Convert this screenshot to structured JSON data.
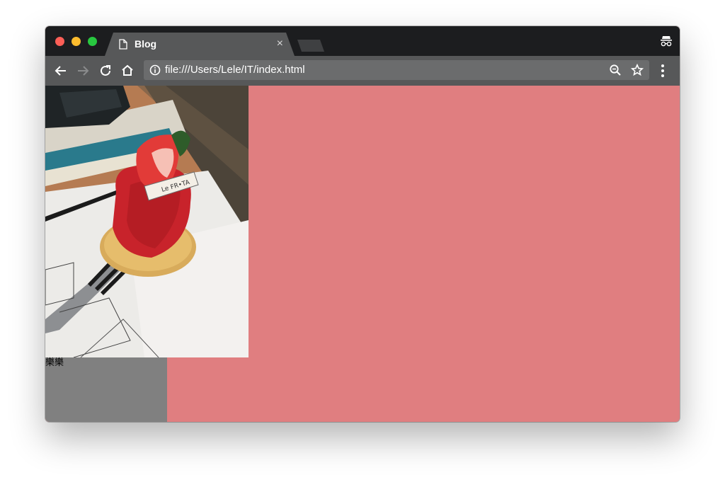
{
  "tab": {
    "title": "Blog",
    "close_label": "×"
  },
  "toolbar": {
    "url": "file:///Users/Lele/IT/index.html"
  },
  "page": {
    "image_label_text": "Le FR•TA",
    "caption_text": "樂樂",
    "background_color": "#e07e80",
    "box_color": "#808080"
  },
  "icons": {
    "back": "arrow-left-icon",
    "forward": "arrow-right-icon",
    "reload": "reload-icon",
    "home": "home-icon",
    "info": "info-icon",
    "zoom": "zoom-icon",
    "bookmark": "star-icon",
    "menu": "kebab-menu-icon",
    "incognito": "incognito-icon"
  }
}
